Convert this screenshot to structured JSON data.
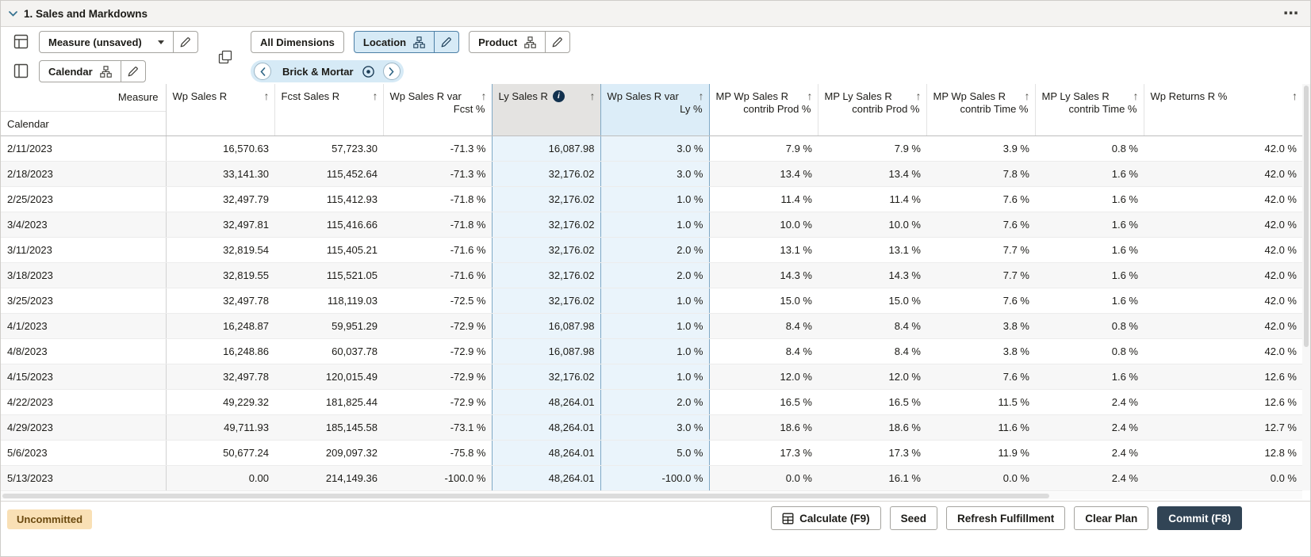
{
  "title_bar": {
    "title": "1. Sales and Markdowns"
  },
  "icons": {
    "sort_ascending": "↑",
    "info_glyph": "i",
    "overflow_menu": "⋯"
  },
  "toolbar": {
    "measure_label": "Measure (unsaved)",
    "calendar_label": "Calendar",
    "all_dimensions_label": "All Dimensions",
    "location_label": "Location",
    "product_label": "Product",
    "context_chip_label": "Brick & Mortar"
  },
  "grid": {
    "corner": {
      "column_dim": "Measure",
      "row_dim": "Calendar"
    },
    "selected_columns": [
      3,
      4
    ],
    "columns": [
      {
        "line1": "Wp Sales R",
        "line2": ""
      },
      {
        "line1": "Fcst Sales R",
        "line2": ""
      },
      {
        "line1": "Wp Sales R var",
        "line2": "Fcst %"
      },
      {
        "line1": "Ly Sales R",
        "line2": "",
        "info_icon": true,
        "highlight": "gray"
      },
      {
        "line1": "Wp Sales R var",
        "line2": "Ly %",
        "highlight": "blue"
      },
      {
        "line1": "MP Wp Sales R",
        "line2": "contrib Prod %"
      },
      {
        "line1": "MP Ly Sales R",
        "line2": "contrib Prod %"
      },
      {
        "line1": "MP Wp Sales R",
        "line2": "contrib Time %"
      },
      {
        "line1": "MP Ly Sales R",
        "line2": "contrib Time %"
      },
      {
        "line1": "Wp Returns R %",
        "line2": ""
      }
    ],
    "rows": [
      {
        "date": "2/11/2023",
        "values": [
          "16,570.63",
          "57,723.30",
          "-71.3 %",
          "16,087.98",
          "3.0 %",
          "7.9 %",
          "7.9 %",
          "3.9 %",
          "0.8 %",
          "42.0 %"
        ]
      },
      {
        "date": "2/18/2023",
        "values": [
          "33,141.30",
          "115,452.64",
          "-71.3 %",
          "32,176.02",
          "3.0 %",
          "13.4 %",
          "13.4 %",
          "7.8 %",
          "1.6 %",
          "42.0 %"
        ]
      },
      {
        "date": "2/25/2023",
        "values": [
          "32,497.79",
          "115,412.93",
          "-71.8 %",
          "32,176.02",
          "1.0 %",
          "11.4 %",
          "11.4 %",
          "7.6 %",
          "1.6 %",
          "42.0 %"
        ]
      },
      {
        "date": "3/4/2023",
        "values": [
          "32,497.81",
          "115,416.66",
          "-71.8 %",
          "32,176.02",
          "1.0 %",
          "10.0 %",
          "10.0 %",
          "7.6 %",
          "1.6 %",
          "42.0 %"
        ]
      },
      {
        "date": "3/11/2023",
        "values": [
          "32,819.54",
          "115,405.21",
          "-71.6 %",
          "32,176.02",
          "2.0 %",
          "13.1 %",
          "13.1 %",
          "7.7 %",
          "1.6 %",
          "42.0 %"
        ]
      },
      {
        "date": "3/18/2023",
        "values": [
          "32,819.55",
          "115,521.05",
          "-71.6 %",
          "32,176.02",
          "2.0 %",
          "14.3 %",
          "14.3 %",
          "7.7 %",
          "1.6 %",
          "42.0 %"
        ]
      },
      {
        "date": "3/25/2023",
        "values": [
          "32,497.78",
          "118,119.03",
          "-72.5 %",
          "32,176.02",
          "1.0 %",
          "15.0 %",
          "15.0 %",
          "7.6 %",
          "1.6 %",
          "42.0 %"
        ]
      },
      {
        "date": "4/1/2023",
        "values": [
          "16,248.87",
          "59,951.29",
          "-72.9 %",
          "16,087.98",
          "1.0 %",
          "8.4 %",
          "8.4 %",
          "3.8 %",
          "0.8 %",
          "42.0 %"
        ]
      },
      {
        "date": "4/8/2023",
        "values": [
          "16,248.86",
          "60,037.78",
          "-72.9 %",
          "16,087.98",
          "1.0 %",
          "8.4 %",
          "8.4 %",
          "3.8 %",
          "0.8 %",
          "42.0 %"
        ]
      },
      {
        "date": "4/15/2023",
        "values": [
          "32,497.78",
          "120,015.49",
          "-72.9 %",
          "32,176.02",
          "1.0 %",
          "12.0 %",
          "12.0 %",
          "7.6 %",
          "1.6 %",
          "12.6 %"
        ]
      },
      {
        "date": "4/22/2023",
        "values": [
          "49,229.32",
          "181,825.44",
          "-72.9 %",
          "48,264.01",
          "2.0 %",
          "16.5 %",
          "16.5 %",
          "11.5 %",
          "2.4 %",
          "12.6 %"
        ]
      },
      {
        "date": "4/29/2023",
        "values": [
          "49,711.93",
          "185,145.58",
          "-73.1 %",
          "48,264.01",
          "3.0 %",
          "18.6 %",
          "18.6 %",
          "11.6 %",
          "2.4 %",
          "12.7 %"
        ]
      },
      {
        "date": "5/6/2023",
        "values": [
          "50,677.24",
          "209,097.32",
          "-75.8 %",
          "48,264.01",
          "5.0 %",
          "17.3 %",
          "17.3 %",
          "11.9 %",
          "2.4 %",
          "12.8 %"
        ]
      },
      {
        "date": "5/13/2023",
        "values": [
          "0.00",
          "214,149.36",
          "-100.0 %",
          "48,264.01",
          "-100.0 %",
          "0.0 %",
          "16.1 %",
          "0.0 %",
          "2.4 %",
          "0.0 %"
        ]
      }
    ]
  },
  "footer": {
    "status_badge": "Uncommitted",
    "buttons": [
      {
        "label": "Calculate (F9)",
        "icon": "calculator"
      },
      {
        "label": "Seed"
      },
      {
        "label": "Refresh Fulfillment"
      },
      {
        "label": "Clear Plan"
      },
      {
        "label": "Commit (F8)",
        "primary": true
      }
    ]
  },
  "colors": {
    "selection_bg": "#eaf4fb",
    "selection_border": "#7fa9c6",
    "accent_chip_bg": "#d6eaf6",
    "accent_chip_border": "#4c7fa6",
    "header_selected_gray": "#e4e3e1",
    "header_selected_blue": "#dcedf8",
    "badge_bg": "#f9e0b5",
    "badge_text": "#6b4a10",
    "primary_button_bg": "#314455",
    "stripe": "#f7f7f7"
  }
}
